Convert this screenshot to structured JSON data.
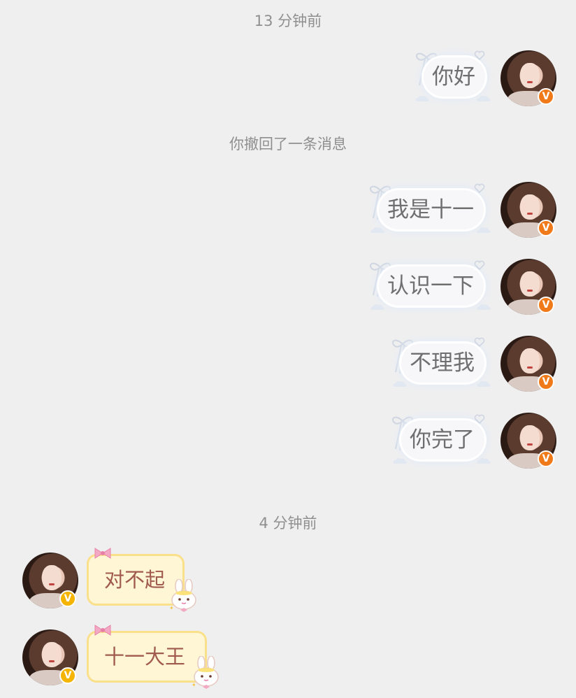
{
  "timestamps": [
    "13 分钟前",
    "4 分钟前"
  ],
  "system_notice": "你撤回了一条消息",
  "sent_messages": [
    "你好",
    "我是十一",
    "认识一下",
    "不理我",
    "你完了"
  ],
  "received_messages": [
    "对不起",
    "十一大王"
  ],
  "badge_letter": "V",
  "colors": {
    "background": "#efefef",
    "sent_badge": "#f07a1a",
    "received_badge": "#f4b400",
    "received_bubble": "#fff6d6",
    "received_text": "#a15a4e",
    "sent_text": "#6f6f6f"
  },
  "icons": {
    "sent_bubble_decoration": "ribbon-bow-icon",
    "received_bubble_decoration": "bunny-sticker-icon",
    "badge": "verified-v-badge-icon"
  }
}
